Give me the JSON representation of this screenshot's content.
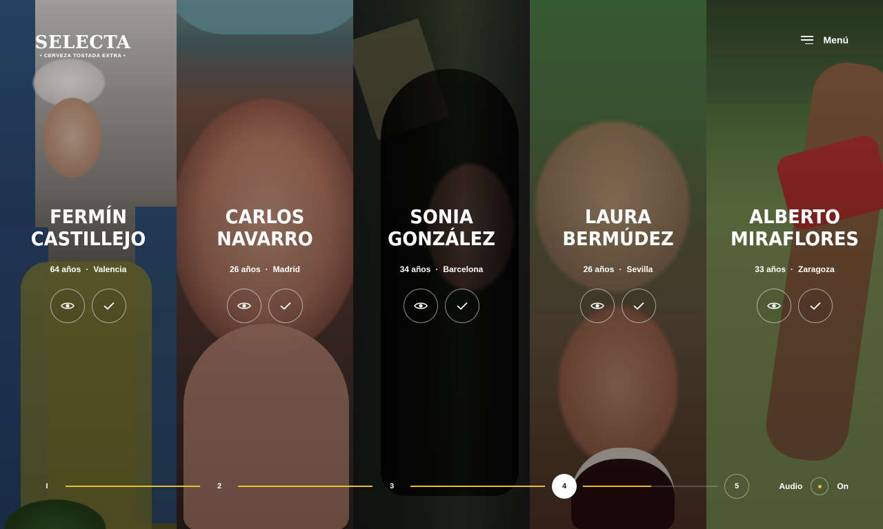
{
  "brand": {
    "name": "SELECTA",
    "tagline": "• CERVEZA TOSTADA EXTRA •"
  },
  "menu": {
    "label": "Menú",
    "icon": "hamburger-icon"
  },
  "people": [
    {
      "first": "FERMÍN",
      "last": "CASTILLEJO",
      "age": "64 años",
      "city": "Valencia"
    },
    {
      "first": "CARLOS",
      "last": "NAVARRO",
      "age": "26 años",
      "city": "Madrid"
    },
    {
      "first": "SONIA",
      "last": "GONZÁLEZ",
      "age": "34 años",
      "city": "Barcelona"
    },
    {
      "first": "LAURA",
      "last": "BERMÚDEZ",
      "age": "26 años",
      "city": "Sevilla"
    },
    {
      "first": "ALBERTO",
      "last": "MIRAFLORES",
      "age": "33 años",
      "city": "Zaragoza"
    }
  ],
  "meta_separator": "·",
  "actions": {
    "view_icon": "eye-icon",
    "select_icon": "check-icon"
  },
  "progress": {
    "steps": [
      "I",
      "2",
      "3",
      "4",
      "5"
    ],
    "active_step": "4",
    "accent": "#e6c22b"
  },
  "audio": {
    "label": "Audio",
    "state": "On"
  }
}
